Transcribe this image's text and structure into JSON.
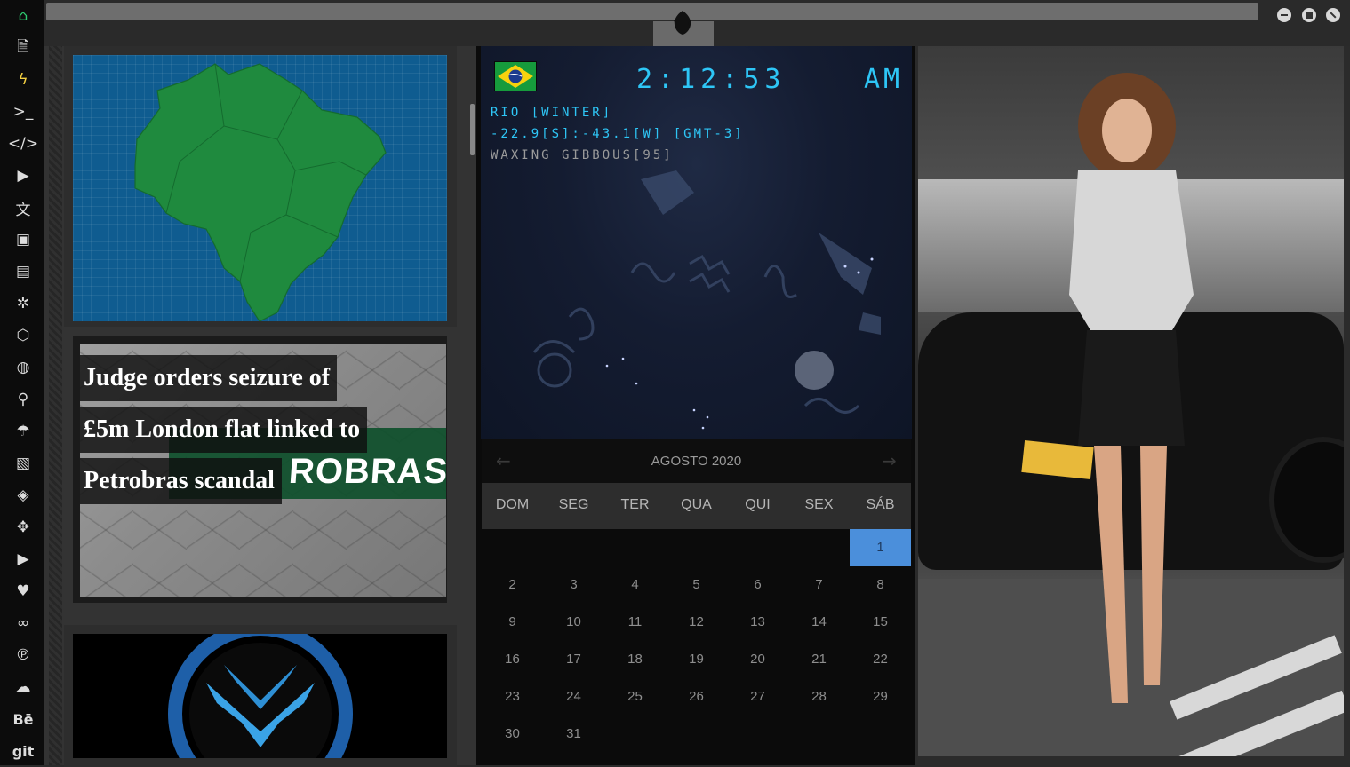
{
  "sidebar": {
    "items": [
      {
        "name": "home-icon",
        "glyph": "⌂"
      },
      {
        "name": "document-icon",
        "glyph": "🗎"
      },
      {
        "name": "bolt-icon",
        "glyph": "ϟ"
      },
      {
        "name": "terminal-icon",
        "glyph": ">_"
      },
      {
        "name": "code-icon",
        "glyph": "</>"
      },
      {
        "name": "play-icon",
        "glyph": "▶"
      },
      {
        "name": "translate-icon",
        "glyph": "文"
      },
      {
        "name": "image-icon",
        "glyph": "▣"
      },
      {
        "name": "newspaper-icon",
        "glyph": "▤"
      },
      {
        "name": "galactic-empire-icon",
        "glyph": "✲"
      },
      {
        "name": "hexagon-icon",
        "glyph": "⬡"
      },
      {
        "name": "globe-icon",
        "glyph": "◍"
      },
      {
        "name": "search-icon",
        "glyph": "⚲"
      },
      {
        "name": "umbrella-icon",
        "glyph": "☂"
      },
      {
        "name": "contact-card-icon",
        "glyph": "▧"
      },
      {
        "name": "code-link-icon",
        "glyph": "◈"
      },
      {
        "name": "expand-icon",
        "glyph": "✥"
      },
      {
        "name": "youtube-icon",
        "glyph": "▶"
      },
      {
        "name": "heart-icon",
        "glyph": "♥"
      },
      {
        "name": "infinity-icon",
        "glyph": "∞"
      },
      {
        "name": "pinterest-icon",
        "glyph": "℗"
      },
      {
        "name": "cloud-icon",
        "glyph": "☁"
      },
      {
        "name": "behance-icon",
        "glyph": "Bē"
      },
      {
        "name": "git-icon",
        "glyph": "git"
      }
    ]
  },
  "window": {
    "logo": "rebel-alliance-icon",
    "buttons": [
      "minimize-button",
      "maximize-button",
      "close-button"
    ]
  },
  "news": {
    "headline_lines": [
      "Judge orders seizure of",
      "£5m London flat linked to",
      "Petrobras scandal"
    ],
    "image_sign_text": "ROBRAS"
  },
  "clock": {
    "time": "2:12:53",
    "ampm": "AM",
    "location": "RIO [WINTER]",
    "coords": "-22.9[S]:-43.1[W] [GMT-3]",
    "moon": "WAXING GIBBOUS[95]",
    "flag": "brazil-flag-icon"
  },
  "calendar": {
    "title": "AGOSTO 2020",
    "prev": "←",
    "next": "→",
    "days_of_week": [
      "DOM",
      "SEG",
      "TER",
      "QUA",
      "QUI",
      "SEX",
      "SÁB"
    ],
    "weeks": [
      [
        "",
        "",
        "",
        "",
        "",
        "",
        "1"
      ],
      [
        "2",
        "3",
        "4",
        "5",
        "6",
        "7",
        "8"
      ],
      [
        "9",
        "10",
        "11",
        "12",
        "13",
        "14",
        "15"
      ],
      [
        "16",
        "17",
        "18",
        "19",
        "20",
        "21",
        "22"
      ],
      [
        "23",
        "24",
        "25",
        "26",
        "27",
        "28",
        "29"
      ],
      [
        "30",
        "31",
        "",
        "",
        "",
        "",
        ""
      ]
    ],
    "today": "1"
  },
  "colors": {
    "accent": "#2ec6f6",
    "today": "#4b8fdb",
    "map_sea": "#0f5c90",
    "map_land": "#1f8a3e"
  }
}
